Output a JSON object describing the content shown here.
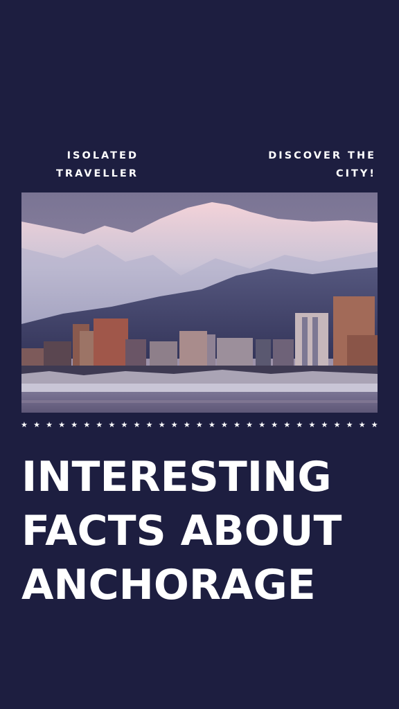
{
  "tagline_left": "ISOLATED\nTRAVELLER",
  "tagline_right": "DISCOVER THE\nCITY!",
  "headline": {
    "line1": "INTERESTING",
    "line2": "FACTS ABOUT",
    "line3": "ANCHORAGE"
  },
  "colors": {
    "background": "#1d1e40",
    "text": "#ffffff"
  }
}
